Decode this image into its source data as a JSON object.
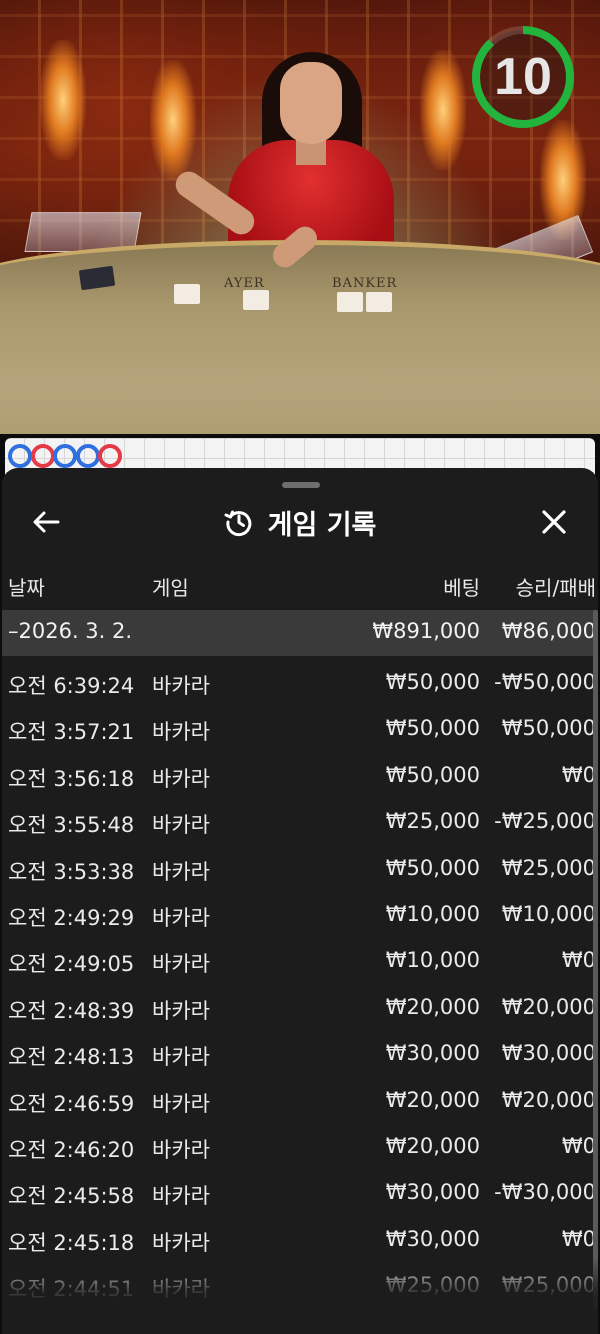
{
  "timer": {
    "seconds": "10",
    "ring_color": "#22b43c"
  },
  "roadmap": {
    "beads": [
      "blue",
      "red",
      "blue",
      "blue",
      "red"
    ],
    "colors": {
      "blue": "#2f6fe0",
      "red": "#e53945"
    }
  },
  "table_labels": {
    "player": "AYER",
    "banker": "BANKER"
  },
  "panel": {
    "title": "게임 기록",
    "title_icon": "history-clock-icon",
    "back_icon": "arrow-left-icon",
    "close_icon": "close-icon"
  },
  "columns": {
    "date": "날짜",
    "game": "게임",
    "bet": "베팅",
    "result": "승리/패배"
  },
  "summary": {
    "date": "–2026. 3. 2.",
    "bet": "₩891,000",
    "result": "₩86,000"
  },
  "rows": [
    {
      "time": "오전 6:39:24",
      "game": "바카라",
      "bet": "₩50,000",
      "result": "-₩50,000"
    },
    {
      "time": "오전 3:57:21",
      "game": "바카라",
      "bet": "₩50,000",
      "result": "₩50,000"
    },
    {
      "time": "오전 3:56:18",
      "game": "바카라",
      "bet": "₩50,000",
      "result": "₩0"
    },
    {
      "time": "오전 3:55:48",
      "game": "바카라",
      "bet": "₩25,000",
      "result": "-₩25,000"
    },
    {
      "time": "오전 3:53:38",
      "game": "바카라",
      "bet": "₩50,000",
      "result": "₩25,000"
    },
    {
      "time": "오전 2:49:29",
      "game": "바카라",
      "bet": "₩10,000",
      "result": "₩10,000"
    },
    {
      "time": "오전 2:49:05",
      "game": "바카라",
      "bet": "₩10,000",
      "result": "₩0"
    },
    {
      "time": "오전 2:48:39",
      "game": "바카라",
      "bet": "₩20,000",
      "result": "₩20,000"
    },
    {
      "time": "오전 2:48:13",
      "game": "바카라",
      "bet": "₩30,000",
      "result": "₩30,000"
    },
    {
      "time": "오전 2:46:59",
      "game": "바카라",
      "bet": "₩20,000",
      "result": "₩20,000"
    },
    {
      "time": "오전 2:46:20",
      "game": "바카라",
      "bet": "₩20,000",
      "result": "₩0"
    },
    {
      "time": "오전 2:45:58",
      "game": "바카라",
      "bet": "₩30,000",
      "result": "-₩30,000"
    },
    {
      "time": "오전 2:45:18",
      "game": "바카라",
      "bet": "₩30,000",
      "result": "₩0"
    },
    {
      "time": "오전 2:44:51",
      "game": "바카라",
      "bet": "₩25,000",
      "result": "₩25,000"
    }
  ]
}
